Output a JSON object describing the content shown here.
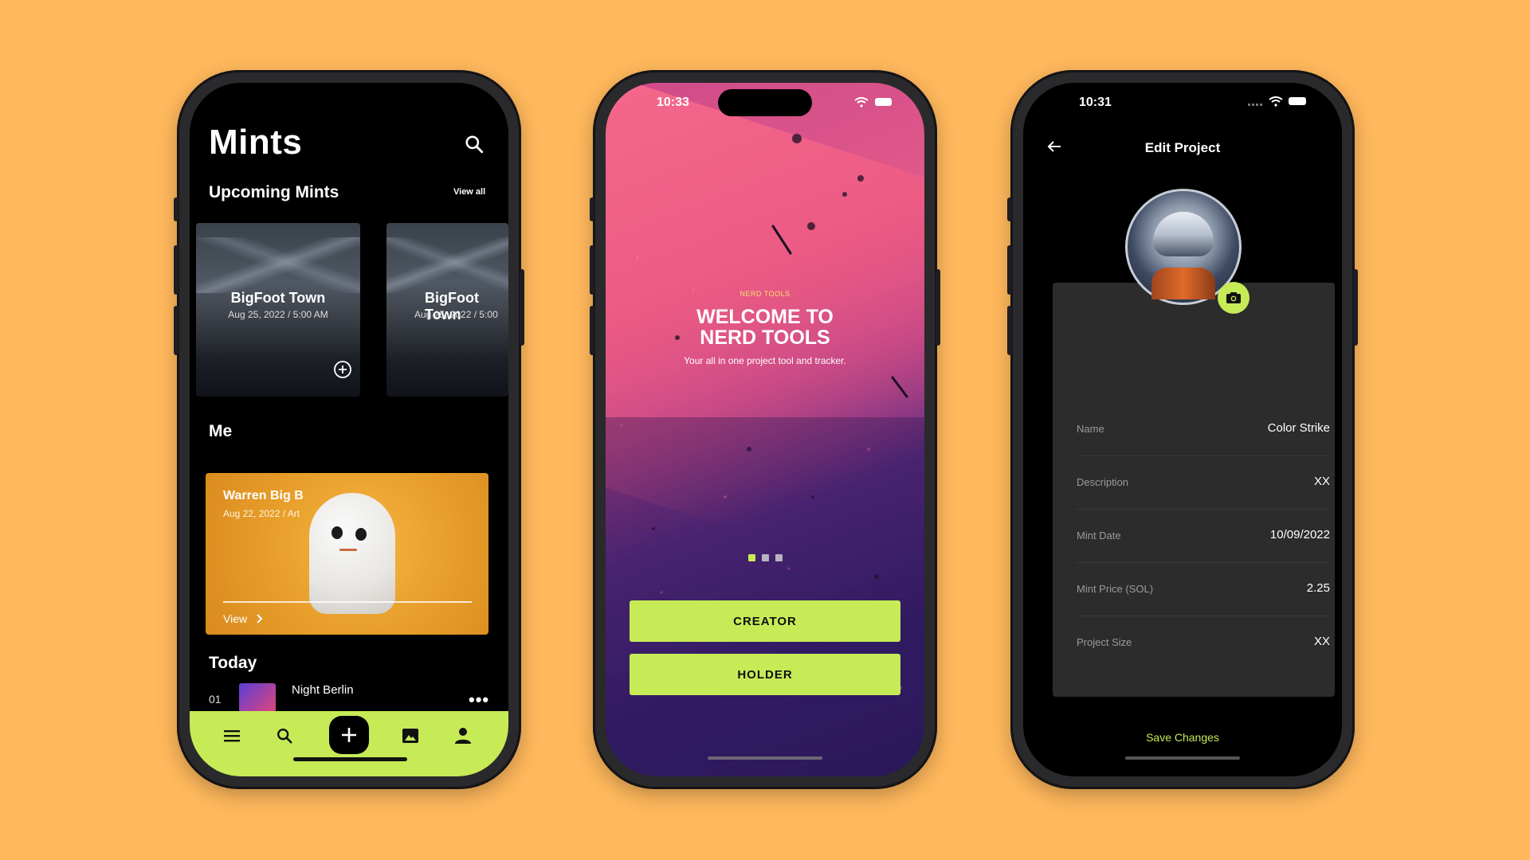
{
  "colors": {
    "background": "#FFB85C",
    "accent": "#C6EB57"
  },
  "phone1": {
    "title": "Mints",
    "upcoming": {
      "title": "Upcoming Mints",
      "view_all": "View all",
      "cards": [
        {
          "name": "BigFoot Town",
          "date": "Aug 25, 2022 / 5:00 AM"
        },
        {
          "name": "BigFoot Town",
          "date": "Aug 25, 2022 / 5:00"
        }
      ]
    },
    "me": {
      "title": "Me",
      "card": {
        "name": "Warren Big B",
        "date": "Aug 22, 2022 / Art",
        "view": "View"
      }
    },
    "today": {
      "title": "Today",
      "items": [
        {
          "index": "01",
          "name": "Night Berlin"
        }
      ]
    },
    "nav": [
      "menu-icon",
      "search-icon",
      "plus-icon",
      "image-icon",
      "person-icon"
    ]
  },
  "phone2": {
    "time": "10:33",
    "eyebrow": "NERD TOOLS",
    "headline_1": "WELCOME TO",
    "headline_2": "NERD TOOLS",
    "tagline": "Your all in one project tool and tracker.",
    "buttons": {
      "creator": "CREATOR",
      "holder": "HOLDER"
    }
  },
  "phone3": {
    "time": "10:31",
    "title": "Edit Project",
    "fields": [
      {
        "label": "Name",
        "value": "Color Strike"
      },
      {
        "label": "Description",
        "value": "XX"
      },
      {
        "label": "Mint Date",
        "value": "10/09/2022"
      },
      {
        "label": "Mint Price (SOL)",
        "value": "2.25"
      },
      {
        "label": "Project Size",
        "value": "XX"
      }
    ],
    "save": "Save Changes"
  }
}
